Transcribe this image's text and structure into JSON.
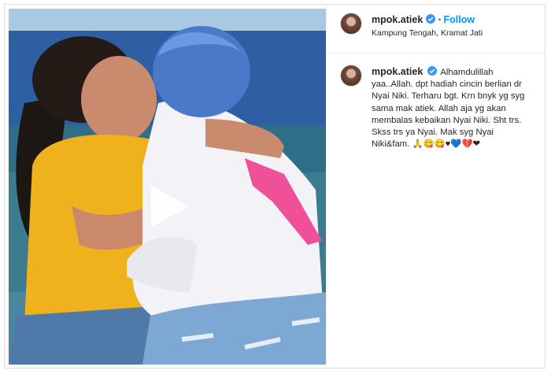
{
  "post": {
    "username": "mpok.atiek",
    "follow_label": "Follow",
    "separator": "•",
    "location": "Kampung Tengah, Kramat Jati",
    "caption": "Alhamdulillah yaa..Allah. dpt hadiah cincin berlian dr Nyai Niki. Terharu bgt. Krn bnyk yg syg sama mak atiek. Allah aja yg akan membalas kebaikan Nyai Niki. Sht trs. Skss trs ya Nyai. Mak syg Nyai Niki&fam. 🙏😋😋♥💙💔❤"
  },
  "colors": {
    "accent": "#0095f6",
    "verified": "#3897f0",
    "text": "#262626",
    "border": "#dbdbdb"
  },
  "icons": {
    "verified": "verified-badge-icon",
    "play": "play-icon"
  }
}
